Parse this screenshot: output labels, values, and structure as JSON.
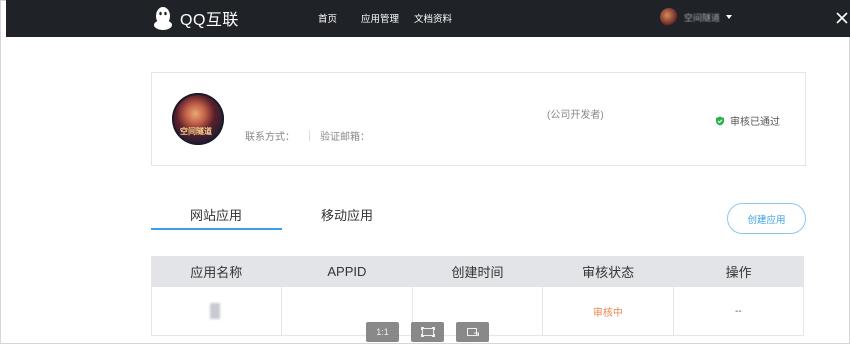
{
  "topbar": {
    "ghost_text": "",
    "logo_text": "QQ互联",
    "nav": [
      {
        "label": "首页"
      },
      {
        "label": "应用管理"
      },
      {
        "label": "文档资料"
      }
    ],
    "user_name": "空间隧道",
    "bg_color": "#1f2227"
  },
  "developer": {
    "avatar_text": "空间隧道",
    "company_name": "",
    "company_type": "(公司开发者)",
    "contact_label": "联系方式：",
    "contact_value": "",
    "email_label": "验证邮箱：",
    "email_value": "",
    "review_status": "审核已通过",
    "status_color": "#2bb24c"
  },
  "tabs": [
    {
      "label": "网站应用",
      "active": true
    },
    {
      "label": "移动应用",
      "active": false
    }
  ],
  "create_button": "创建应用",
  "accent_color": "#3a9fe6",
  "table": {
    "headers": [
      "应用名称",
      "APPID",
      "创建时间",
      "审核状态",
      "操作"
    ],
    "rows": [
      {
        "name": "",
        "appid": "",
        "created": "",
        "status": "审核中",
        "action": "--"
      }
    ]
  },
  "viewer_controls": [
    {
      "label": "1:1",
      "icon": "actual-size-icon"
    },
    {
      "label": "",
      "icon": "fit-screen-icon"
    },
    {
      "label": "",
      "icon": "rotate-icon"
    }
  ]
}
